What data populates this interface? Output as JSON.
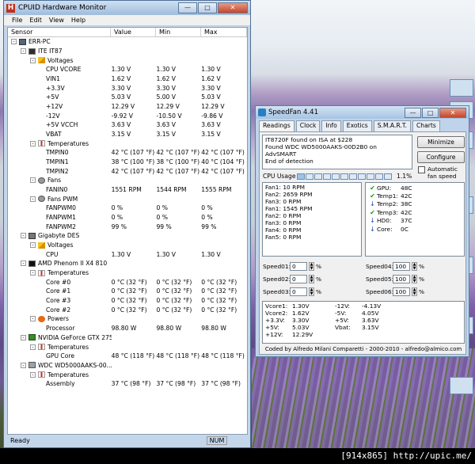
{
  "hwm": {
    "title": "CPUID Hardware Monitor",
    "menu": [
      "File",
      "Edit",
      "View",
      "Help"
    ],
    "columns": [
      "Sensor",
      "Value",
      "Min",
      "Max"
    ],
    "rows": [
      {
        "indent": 0,
        "icon": "pc",
        "exp": "-",
        "label": "ERR-PC"
      },
      {
        "indent": 1,
        "icon": "chip",
        "exp": "-",
        "label": "ITE IT87"
      },
      {
        "indent": 2,
        "icon": "volt",
        "exp": "-",
        "label": "Voltages"
      },
      {
        "indent": 3,
        "label": "CPU VCORE",
        "v": "1.30 V",
        "min": "1.30 V",
        "max": "1.30 V"
      },
      {
        "indent": 3,
        "label": "VIN1",
        "v": "1.62 V",
        "min": "1.62 V",
        "max": "1.62 V"
      },
      {
        "indent": 3,
        "label": "+3.3V",
        "v": "3.30 V",
        "min": "3.30 V",
        "max": "3.30 V"
      },
      {
        "indent": 3,
        "label": "+5V",
        "v": "5.03 V",
        "min": "5.00 V",
        "max": "5.03 V"
      },
      {
        "indent": 3,
        "label": "+12V",
        "v": "12.29 V",
        "min": "12.29 V",
        "max": "12.29 V"
      },
      {
        "indent": 3,
        "label": "-12V",
        "v": "-9.92 V",
        "min": "-10.50 V",
        "max": "-9.86 V"
      },
      {
        "indent": 3,
        "label": "+5V VCCH",
        "v": "3.63 V",
        "min": "3.63 V",
        "max": "3.63 V"
      },
      {
        "indent": 3,
        "label": "VBAT",
        "v": "3.15 V",
        "min": "3.15 V",
        "max": "3.15 V"
      },
      {
        "indent": 2,
        "icon": "temp",
        "exp": "-",
        "label": "Temperatures"
      },
      {
        "indent": 3,
        "label": "TMPIN0",
        "v": "42 °C  (107 °F)",
        "min": "42 °C  (107 °F)",
        "max": "42 °C  (107 °F)"
      },
      {
        "indent": 3,
        "label": "TMPIN1",
        "v": "38 °C  (100 °F)",
        "min": "38 °C  (100 °F)",
        "max": "40 °C  (104 °F)"
      },
      {
        "indent": 3,
        "label": "TMPIN2",
        "v": "42 °C  (107 °F)",
        "min": "42 °C  (107 °F)",
        "max": "42 °C  (107 °F)"
      },
      {
        "indent": 2,
        "icon": "fan",
        "exp": "-",
        "label": "Fans"
      },
      {
        "indent": 3,
        "label": "FANIN0",
        "v": "1551 RPM",
        "min": "1544 RPM",
        "max": "1555 RPM"
      },
      {
        "indent": 2,
        "icon": "fan",
        "exp": "-",
        "label": "Fans PWM"
      },
      {
        "indent": 3,
        "label": "FANPWM0",
        "v": "0 %",
        "min": "0 %",
        "max": "0 %"
      },
      {
        "indent": 3,
        "label": "FANPWM1",
        "v": "0 %",
        "min": "0 %",
        "max": "0 %"
      },
      {
        "indent": 3,
        "label": "FANPWM2",
        "v": "99 %",
        "min": "99 %",
        "max": "99 %"
      },
      {
        "indent": 1,
        "icon": "gig",
        "exp": "-",
        "label": "Gigabyte DES"
      },
      {
        "indent": 2,
        "icon": "volt",
        "exp": "-",
        "label": "Voltages"
      },
      {
        "indent": 3,
        "label": "CPU",
        "v": "1.30 V",
        "min": "1.30 V",
        "max": "1.30 V"
      },
      {
        "indent": 1,
        "icon": "amd",
        "exp": "-",
        "label": "AMD Phenom II X4 810"
      },
      {
        "indent": 2,
        "icon": "temp",
        "exp": "-",
        "label": "Temperatures"
      },
      {
        "indent": 3,
        "label": "Core #0",
        "v": "0 °C  (32 °F)",
        "min": "0 °C  (32 °F)",
        "max": "0 °C  (32 °F)"
      },
      {
        "indent": 3,
        "label": "Core #1",
        "v": "0 °C  (32 °F)",
        "min": "0 °C  (32 °F)",
        "max": "0 °C  (32 °F)"
      },
      {
        "indent": 3,
        "label": "Core #3",
        "v": "0 °C  (32 °F)",
        "min": "0 °C  (32 °F)",
        "max": "0 °C  (32 °F)"
      },
      {
        "indent": 3,
        "label": "Core #2",
        "v": "0 °C  (32 °F)",
        "min": "0 °C  (32 °F)",
        "max": "0 °C  (32 °F)"
      },
      {
        "indent": 2,
        "icon": "power",
        "exp": "-",
        "label": "Powers"
      },
      {
        "indent": 3,
        "label": "Processor",
        "v": "98.80 W",
        "min": "98.80 W",
        "max": "98.80 W"
      },
      {
        "indent": 1,
        "icon": "gpu",
        "exp": "-",
        "label": "NVIDIA GeForce GTX 275"
      },
      {
        "indent": 2,
        "icon": "temp",
        "exp": "-",
        "label": "Temperatures"
      },
      {
        "indent": 3,
        "label": "GPU Core",
        "v": "48 °C  (118 °F)",
        "min": "48 °C  (118 °F)",
        "max": "48 °C  (118 °F)"
      },
      {
        "indent": 1,
        "icon": "hdd",
        "exp": "-",
        "label": "WDC WD5000AAKS-00..."
      },
      {
        "indent": 2,
        "icon": "temp",
        "exp": "-",
        "label": "Temperatures"
      },
      {
        "indent": 3,
        "label": "Assembly",
        "v": "37 °C  (98 °F)",
        "min": "37 °C  (98 °F)",
        "max": "37 °C  (98 °F)"
      }
    ],
    "status": "Ready",
    "num": "NUM"
  },
  "speedfan": {
    "title": "SpeedFan 4.41",
    "tabs": [
      "Readings",
      "Clock",
      "Info",
      "Exotics",
      "S.M.A.R.T.",
      "Charts"
    ],
    "log": [
      "IT8720F found on ISA at $228",
      "Found WDC WD5000AAKS-00D2B0 on AdvSMART",
      "End of detection"
    ],
    "minimize_label": "Minimize",
    "configure_label": "Configure",
    "auto_fan_label": "Automatic fan speed",
    "cpu_usage_label": "CPU Usage",
    "cpu_usage_value": "1.1%",
    "cpu_usage_fraction": 0.011,
    "fans": [
      "Fan1: 10 RPM",
      "Fan2: 2659 RPM",
      "Fan3: 0 RPM",
      "Fan1: 1545 RPM",
      "Fan2: 0 RPM",
      "Fan3: 0 RPM",
      "Fan4: 0 RPM",
      "Fan5: 0 RPM"
    ],
    "temps": [
      {
        "icon": "check-icon",
        "name": "GPU:",
        "value": "48C"
      },
      {
        "icon": "check-icon",
        "name": "Temp1:",
        "value": "42C"
      },
      {
        "icon": "arrow-down-icon",
        "name": "Temp2:",
        "value": "38C"
      },
      {
        "icon": "check-icon",
        "name": "Temp3:",
        "value": "42C"
      },
      {
        "icon": "arrow-down-icon",
        "name": "HD0:",
        "value": "37C"
      },
      {
        "icon": "arrow-down-icon",
        "name": "Core:",
        "value": "0C"
      }
    ],
    "speeds_left": [
      {
        "label": "Speed01:",
        "value": "0",
        "unit": "%"
      },
      {
        "label": "Speed02:",
        "value": "0",
        "unit": "%"
      },
      {
        "label": "Speed03:",
        "value": "0",
        "unit": "%"
      }
    ],
    "speeds_right": [
      {
        "label": "Speed04:",
        "value": "100",
        "unit": "%"
      },
      {
        "label": "Speed05:",
        "value": "100",
        "unit": "%"
      },
      {
        "label": "Speed06:",
        "value": "100",
        "unit": "%"
      }
    ],
    "volts_left": [
      {
        "name": "Vcore1:",
        "value": "1.30V"
      },
      {
        "name": "Vcore2:",
        "value": "1.62V"
      },
      {
        "name": "+3.3V:",
        "value": "3.30V"
      },
      {
        "name": "+5V:",
        "value": "5.03V"
      },
      {
        "name": "+12V:",
        "value": "12.29V"
      }
    ],
    "volts_right": [
      {
        "name": "-12V:",
        "value": "-4.13V"
      },
      {
        "name": "-5V:",
        "value": "4.05V"
      },
      {
        "name": "+5V:",
        "value": "3.63V"
      },
      {
        "name": "Vbat:",
        "value": "3.15V"
      }
    ],
    "footer": "Coded by Alfredo Milani Comparetti - 2000-2010 - alfredo@almico.com"
  },
  "watermark": "[914x865] http://upic.me/"
}
